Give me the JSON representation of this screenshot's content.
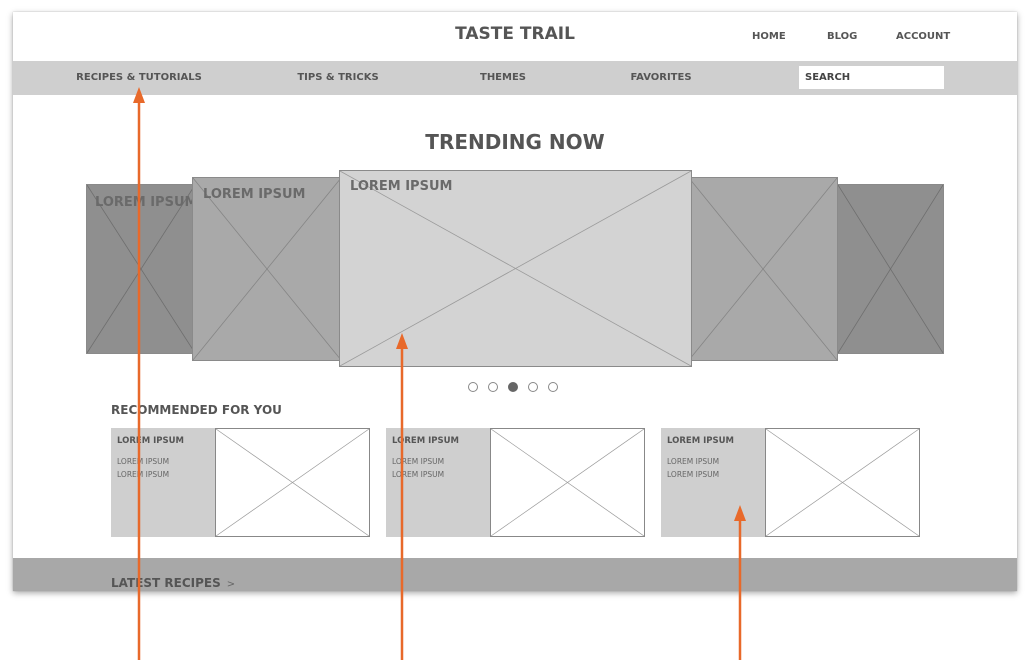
{
  "header": {
    "site_title": "TASTE TRAIL",
    "links": [
      "HOME",
      "BLOG",
      "ACCOUNT"
    ]
  },
  "nav": {
    "items": [
      "RECIPES & TUTORIALS",
      "TIPS & TRICKS",
      "THEMES",
      "FAVORITES"
    ],
    "search_placeholder": "SEARCH"
  },
  "trending": {
    "title": "TRENDING NOW",
    "slide_label": "LOREM IPSUM",
    "slide_count": 5,
    "active_slide_index": 2
  },
  "recommended": {
    "title": "RECOMMENDED FOR YOU",
    "cards": [
      {
        "title": "LOREM IPSUM",
        "lines": [
          "LOREM IPSUM",
          "LOREM IPSUM"
        ]
      },
      {
        "title": "LOREM IPSUM",
        "lines": [
          "LOREM IPSUM",
          "LOREM IPSUM"
        ]
      },
      {
        "title": "LOREM IPSUM",
        "lines": [
          "LOREM IPSUM",
          "LOREM IPSUM"
        ]
      }
    ]
  },
  "latest": {
    "title": "LATEST RECIPES",
    "chevron": ">"
  },
  "colors": {
    "annotation_arrow": "#e8692a",
    "nav_background": "#cfcfcf",
    "footer_band": "#a8a8a8"
  }
}
